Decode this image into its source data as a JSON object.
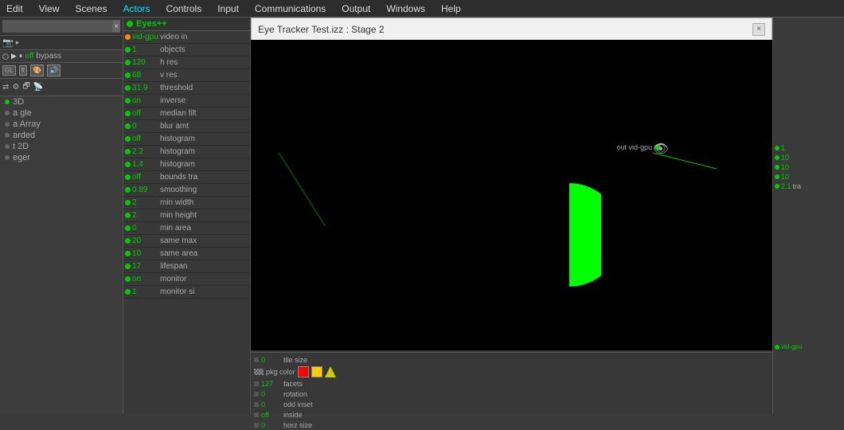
{
  "menubar": {
    "items": [
      {
        "label": "Edit",
        "id": "edit"
      },
      {
        "label": "View",
        "id": "view"
      },
      {
        "label": "Scenes",
        "id": "scenes"
      },
      {
        "label": "Actors",
        "id": "actors",
        "cyan": true
      },
      {
        "label": "Controls",
        "id": "controls"
      },
      {
        "label": "Input",
        "id": "input"
      },
      {
        "label": "Communications",
        "id": "communications"
      },
      {
        "label": "Output",
        "id": "output"
      },
      {
        "label": "Windows",
        "id": "windows"
      },
      {
        "label": "Help",
        "id": "help"
      }
    ]
  },
  "search": {
    "placeholder": "",
    "close_label": "×"
  },
  "toolbar": {
    "camera_icon": "📷",
    "status_off": "off",
    "bypass": "bypass",
    "play_icon": "▶",
    "pause_icon": "⏸",
    "stop_icon": "■"
  },
  "sidebar": {
    "items": [
      {
        "label": "3D",
        "dot": "green"
      },
      {
        "label": "a gle",
        "dot": "gray"
      },
      {
        "label": "a Array",
        "dot": "gray"
      },
      {
        "label": "arded",
        "dot": "gray"
      },
      {
        "label": "t 2D",
        "dot": "gray"
      },
      {
        "label": "eger",
        "dot": "gray"
      }
    ]
  },
  "actor": {
    "name": "Eyes++",
    "params": [
      {
        "dot": "orange",
        "value": "vid-gpu",
        "label": "video in"
      },
      {
        "dot": "green",
        "value": "1",
        "label": "objects"
      },
      {
        "dot": "green",
        "value": "120",
        "label": "h res"
      },
      {
        "dot": "green",
        "value": "68",
        "label": "v res"
      },
      {
        "dot": "green",
        "value": "31.9",
        "label": "threshold"
      },
      {
        "dot": "green",
        "value": "on",
        "label": "inverse"
      },
      {
        "dot": "green",
        "value": "off",
        "label": "median filt"
      },
      {
        "dot": "green",
        "value": "0",
        "label": "blur amt"
      },
      {
        "dot": "green",
        "value": "off",
        "label": "histogram"
      },
      {
        "dot": "green",
        "value": "2.2",
        "label": "histogram"
      },
      {
        "dot": "green",
        "value": "1.4",
        "label": "histogram"
      },
      {
        "dot": "green",
        "value": "off",
        "label": "bounds tra"
      },
      {
        "dot": "green",
        "value": "0.89",
        "label": "smoothing"
      },
      {
        "dot": "green",
        "value": "2",
        "label": "min width"
      },
      {
        "dot": "green",
        "value": "2",
        "label": "min height"
      },
      {
        "dot": "green",
        "value": "0",
        "label": "min area"
      },
      {
        "dot": "green",
        "value": "20",
        "label": "same max"
      },
      {
        "dot": "green",
        "value": "10",
        "label": "same area"
      },
      {
        "dot": "green",
        "value": "17",
        "label": "lifespan"
      },
      {
        "dot": "green",
        "value": "on",
        "label": "monitor"
      },
      {
        "dot": "green",
        "value": "1",
        "label": "monitor si"
      }
    ]
  },
  "stage": {
    "title": "Eye Tracker Test.izz : Stage 2",
    "close": "×"
  },
  "bottom_props": {
    "rows": [
      {
        "dot": "gray",
        "value": "0",
        "label": "tile size"
      },
      {
        "dot": "checker",
        "value": "",
        "label": "pkg color",
        "has_color_btns": true
      },
      {
        "dot": "gray",
        "value": "127",
        "label": "facets"
      },
      {
        "dot": "gray",
        "value": "0",
        "label": "rotation"
      },
      {
        "dot": "gray",
        "value": "0",
        "label": "odd inset"
      },
      {
        "dot": "gray",
        "value": "off",
        "label": "inside"
      },
      {
        "dot": "gray",
        "value": "0",
        "label": "horz size"
      }
    ]
  },
  "right_panel": {
    "vid_gpu_label": "out vid-gpu",
    "params": [
      {
        "dot": "green",
        "value": "1",
        "label": ""
      },
      {
        "dot": "green",
        "value": "10",
        "label": ""
      },
      {
        "dot": "green",
        "value": "10",
        "label": ""
      },
      {
        "dot": "green",
        "value": "10",
        "label": ""
      },
      {
        "dot": "green",
        "value": "2.1",
        "label": "tra"
      }
    ]
  }
}
